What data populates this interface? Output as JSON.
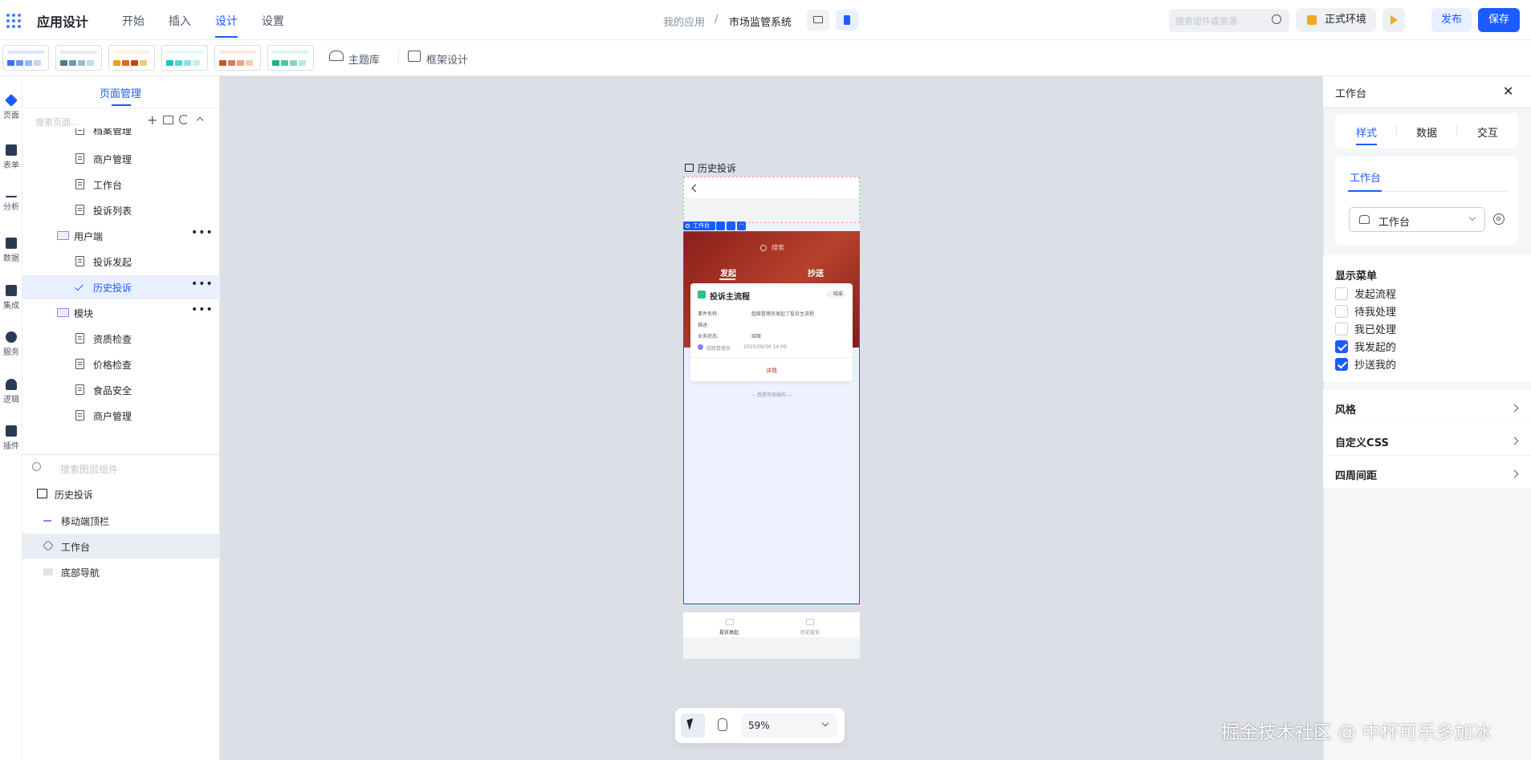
{
  "app": {
    "title": "应用设计"
  },
  "topnav": {
    "start": "开始",
    "insert": "插入",
    "design": "设计",
    "settings": "设置"
  },
  "breadcrumb": {
    "root": "我的应用",
    "sep": "/",
    "current": "市场监管系统"
  },
  "search": {
    "placeholder": "搜索组件或资源"
  },
  "env": {
    "label": "正式环境"
  },
  "actions": {
    "publish": "发布",
    "save": "保存"
  },
  "toolbar": {
    "theme_library": "主题库",
    "frame_design": "框架设计"
  },
  "themes": [
    {
      "bar": "#dbe6ff",
      "c": [
        "#3b6ef5",
        "#6b93f7",
        "#9db8fa",
        "#c7d6fc"
      ]
    },
    {
      "bar": "#e6edf0",
      "c": [
        "#4b7a8c",
        "#6e9aab",
        "#9bbcc9",
        "#c7dbe3"
      ]
    },
    {
      "bar": "#fff2df",
      "c": [
        "#f29b1e",
        "#e06d10",
        "#c8421b",
        "#f6c882"
      ]
    },
    {
      "bar": "#e2f8f8",
      "c": [
        "#19c3c7",
        "#54d4d7",
        "#8ce2e4",
        "#c4f0f1"
      ]
    },
    {
      "bar": "#fce8e0",
      "c": [
        "#c8552b",
        "#dd7b53",
        "#eaa384",
        "#f4cbba"
      ]
    },
    {
      "bar": "#e0f6ef",
      "c": [
        "#1bb38a",
        "#4ac6a3",
        "#80d8bf",
        "#bce9dc"
      ]
    }
  ],
  "rail": [
    {
      "label": "页面"
    },
    {
      "label": "表单"
    },
    {
      "label": "分析"
    },
    {
      "label": "数据"
    },
    {
      "label": "集成"
    },
    {
      "label": "服务"
    },
    {
      "label": "逻辑"
    },
    {
      "label": "插件"
    }
  ],
  "pages_panel": {
    "title": "页面管理",
    "search_placeholder": "搜索页面...",
    "partial_top": "档案管理",
    "items": [
      {
        "label": "商户管理"
      },
      {
        "label": "工作台"
      },
      {
        "label": "投诉列表"
      }
    ],
    "folder_user": "用户端",
    "user_items": [
      {
        "label": "投诉发起"
      },
      {
        "label": "历史投诉"
      }
    ],
    "folder_module": "模块",
    "module_items": [
      {
        "label": "资质检查"
      },
      {
        "label": "价格检查"
      },
      {
        "label": "食品安全"
      },
      {
        "label": "商户管理"
      }
    ]
  },
  "layers": {
    "search_placeholder": "搜索图层组件",
    "root": "历史投诉",
    "items": [
      {
        "label": "移动端顶栏"
      },
      {
        "label": "工作台"
      },
      {
        "label": "底部导航"
      }
    ]
  },
  "phone": {
    "page_title": "历史投诉",
    "component_tag": "工作台",
    "search": "搜索",
    "tab_initiate": "发起",
    "tab_cc": "抄送",
    "card": {
      "title": "投诉主流程",
      "badge": "结束",
      "f1_label": "事件名称:",
      "f1_value": "超级管理员发起了投诉主流程",
      "f2_label": "描述:",
      "f3_label": "业务状态:",
      "f3_value": "结案",
      "user": "超级管理员",
      "time": "2025/09/30 14:09",
      "detail": "详情"
    },
    "end_text": "— 我是有底线的 —",
    "nav_left": "投诉发起",
    "nav_right": "历史投诉"
  },
  "zoom": {
    "value": "59%"
  },
  "right": {
    "title": "工作台",
    "tabs": {
      "style": "样式",
      "data": "数据",
      "interact": "交互"
    },
    "sub_tab": "工作台",
    "select_value": "工作台",
    "menu_title": "显示菜单",
    "menus": [
      {
        "label": "发起流程",
        "checked": false
      },
      {
        "label": "待我处理",
        "checked": false
      },
      {
        "label": "我已处理",
        "checked": false
      },
      {
        "label": "我发起的",
        "checked": true
      },
      {
        "label": "抄送我的",
        "checked": true
      }
    ],
    "style_section": "风格",
    "css_section": "自定义CSS",
    "spacing_section": "四周间距"
  },
  "watermark": "掘金技术社区 @ 中杯可乐多加冰",
  "colors": {
    "accent": "#1a5cff",
    "phone_header": "#9c2b25"
  }
}
